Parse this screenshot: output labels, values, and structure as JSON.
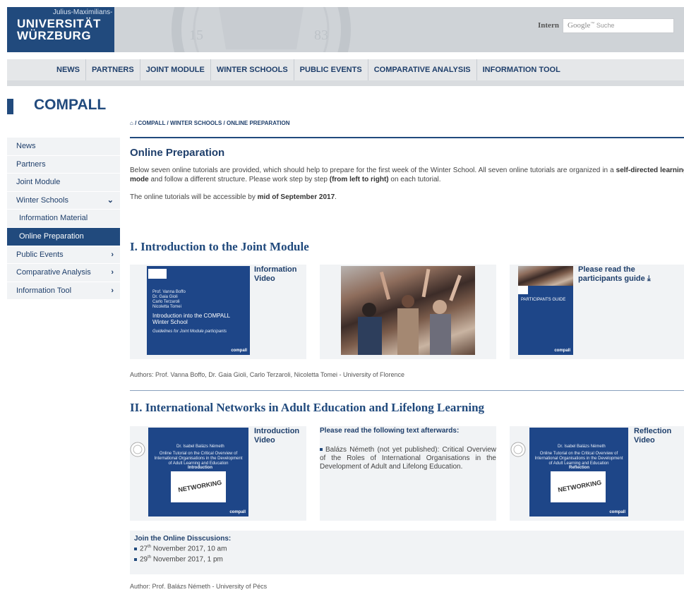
{
  "header": {
    "logo_sup": "Julius-Maximilians-",
    "logo_line1": "UNIVERSITÄT",
    "logo_line2": "WÜRZBURG",
    "seal_year_left": "15",
    "seal_year_right": "83",
    "intern_link": "Intern",
    "search_google": "Google",
    "search_placeholder": "Suche"
  },
  "topnav": {
    "items": [
      "NEWS",
      "PARTNERS",
      "JOINT MODULE",
      "WINTER SCHOOLS",
      "PUBLIC EVENTS",
      "COMPARATIVE ANALYSIS",
      "INFORMATION TOOL"
    ]
  },
  "site_title": "COMPALL",
  "sidebar": {
    "items": [
      {
        "label": "News"
      },
      {
        "label": "Partners"
      },
      {
        "label": "Joint Module"
      },
      {
        "label": "Winter Schools",
        "arrow": "⌄"
      },
      {
        "label": "Information Material"
      },
      {
        "label": "Online Preparation"
      },
      {
        "label": "Public Events",
        "arrow": "›"
      },
      {
        "label": "Comparative Analysis",
        "arrow": "›"
      },
      {
        "label": "Information Tool",
        "arrow": "›"
      }
    ]
  },
  "breadcrumb": "COMPALL / WINTER SCHOOLS / ONLINE PREPARATION",
  "page": {
    "heading": "Online Preparation",
    "intro_1a": "Below seven online tutorials are provided, which should help to prepare for the first week of the Winter School. All seven online tutorials are organized in a",
    "intro_1b": "self-directed learning mode",
    "intro_1c": " and follow a different structure. Please work step by step ",
    "intro_1d": "(from left to right)",
    "intro_1e": " on each tutorial.",
    "intro_2a": "The online tutorials will be accessible by ",
    "intro_2b": "mid of September 2017",
    "intro_2c": "."
  },
  "section1": {
    "heading": "I. Introduction to the Joint Module",
    "video_label": "Information Video",
    "slide_names": "Prof. Vanna Boffo\nDr. Gaia Gioli\nCarlo Terzaroli\nNicoletta Tomei",
    "slide_title": "Introduction into the COMPALL Winter School",
    "slide_sub": "Guidelines for Joint Module participants",
    "slide_logo": "compall",
    "guide_label": "Please read the participants guide",
    "guide_cover_title": "PARTICIPANTS GUIDE",
    "authors": "Authors: Prof. Vanna Boffo, Dr. Gaia Gioli, Carlo Terzaroli, Nicoletta Tomei - University of Florence"
  },
  "section2": {
    "heading": "II. International Networks in Adult Education and Lifelong Learning",
    "intro_video_label": "Introduction Video",
    "slide_author": "Dr. Isabel Balázs Németh",
    "slide_title": "Online Tutorial on the Critical Overview of International Organisations in the Development of Adult Learning and Education",
    "slide_intro": "Introduction",
    "slide_reflection": "Reflection",
    "networking_word": "NETWORKING",
    "reading_heading": "Please read the following text afterwards:",
    "reading_text": "Balázs Németh (not yet published): Critical Overview of the Roles of International Organisations in the Development of Adult and Lifelong Education.",
    "reflection_label": "Reflection Video",
    "join_heading": "Join the Online Disscusions:",
    "join_1_day": "27",
    "join_1_rest": " November 2017, 10 am",
    "join_2_day": "29",
    "join_2_rest": " November 2017, 1 pm",
    "ordinal": "th",
    "author": "Author: Prof. Balázs Németh - University of Pécs"
  },
  "colors": {
    "brand_blue": "#214a7d",
    "light_panel": "#f1f3f5",
    "header_gray": "#cfd3d7"
  }
}
